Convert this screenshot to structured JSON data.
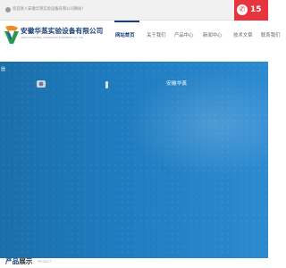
{
  "topbar": {
    "welcome_text": "欢迎进入安徽华蒸实验设备有限公司网站!",
    "phone_number": "15",
    "phone_icon": "phone-icon",
    "colors": {
      "background": "#f1f1f1",
      "phone_background": "#e8343f"
    }
  },
  "header": {
    "logo_icon": "company-logo-icon",
    "company_name": "安徽华蒸实验设备有限公司",
    "company_name_en": "ANHUI HUAZHENG LABORATORY EQUIPMENT CO., LTD",
    "nav_items": [
      {
        "label": "网站首页",
        "active": true
      },
      {
        "label": "关于我们",
        "active": false
      },
      {
        "label": "产品中心",
        "active": false
      },
      {
        "label": "新闻中心",
        "active": false
      },
      {
        "label": "技术文章",
        "active": false
      },
      {
        "label": "联系我们",
        "active": false
      }
    ],
    "colors": {
      "brand": "#1d3f80",
      "nav_text": "#666666"
    }
  },
  "banner": {
    "edge_text": "器",
    "brand_text": "安徽华蒸",
    "colors": {
      "background": "#1f7cc0"
    }
  },
  "products": {
    "title_part1": "产品",
    "title_part2": "展示",
    "title_en": "PRODUCT"
  }
}
